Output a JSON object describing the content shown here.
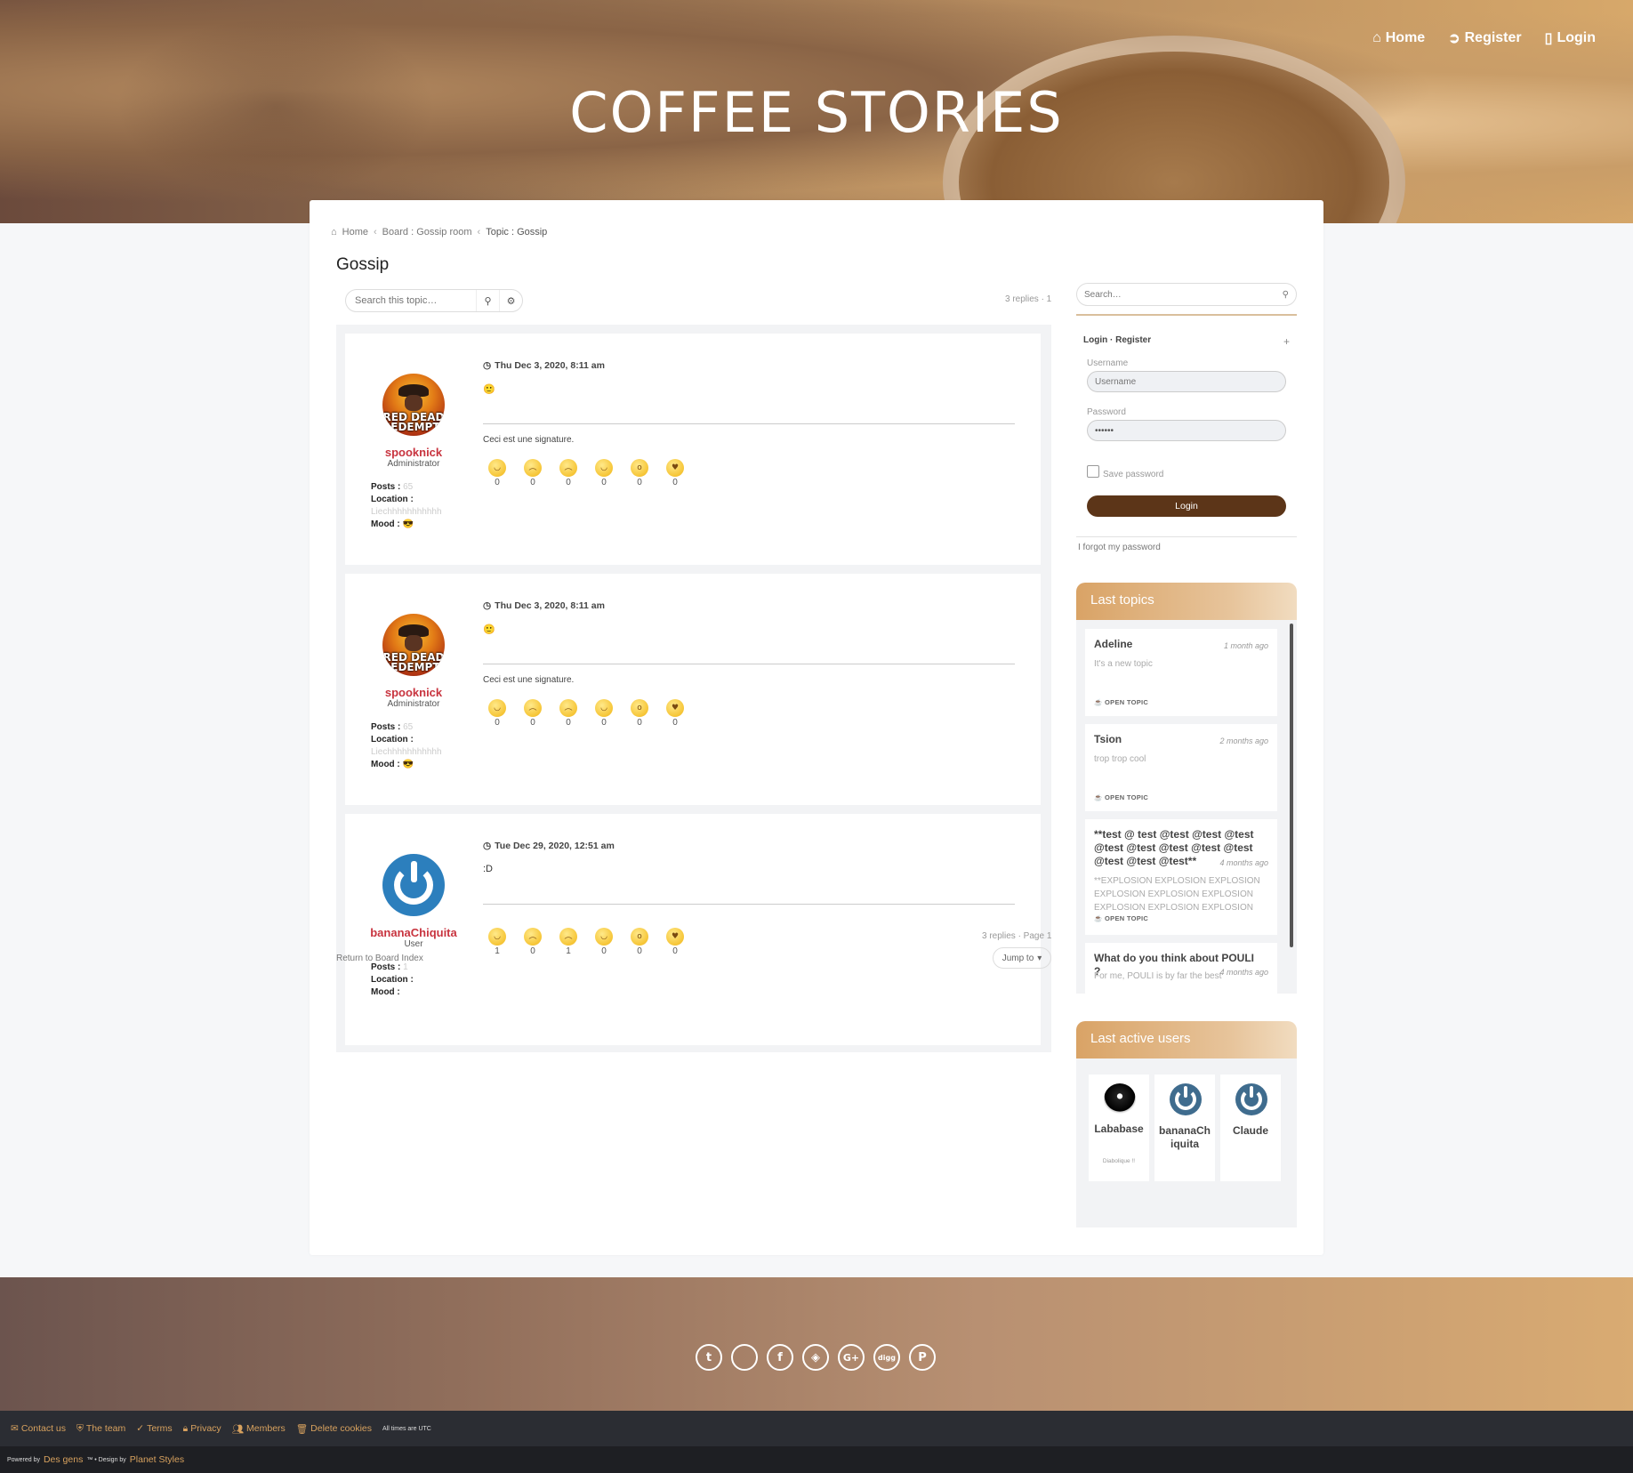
{
  "header": {
    "site_title": "COFFEE STORIES",
    "nav": [
      {
        "label": "Home",
        "icon": "home-icon"
      },
      {
        "label": "Register",
        "icon": "register-icon"
      },
      {
        "label": "Login",
        "icon": "clipboard-icon"
      }
    ]
  },
  "breadcrumb": {
    "home": "Home",
    "board": "Board : Gossip room",
    "topic": "Topic : Gossip"
  },
  "topic": {
    "title": "Gossip",
    "search_placeholder": "Search this topic…",
    "replies_top": "3 replies · 1",
    "replies_bottom": "3 replies · Page 1",
    "return_link": "Return to Board Index",
    "jump_to": "Jump to"
  },
  "posts": [
    {
      "username": "spooknick",
      "rank": "Administrator",
      "posts_label": "Posts :",
      "posts_value": "65",
      "location_label": "Location :",
      "location_value": "Liechhhhhhhhhhh",
      "mood_label": "Mood :",
      "mood_icon": "😎",
      "date": "Thu Dec 3, 2020, 8:11 am",
      "content": "🙂",
      "signature": "Ceci est une signature.",
      "reactions": [
        "0",
        "0",
        "0",
        "0",
        "0",
        "0"
      ]
    },
    {
      "username": "spooknick",
      "rank": "Administrator",
      "posts_label": "Posts :",
      "posts_value": "65",
      "location_label": "Location :",
      "location_value": "Liechhhhhhhhhhh",
      "mood_label": "Mood :",
      "mood_icon": "😎",
      "date": "Thu Dec 3, 2020, 8:11 am",
      "content": "🙂",
      "signature": "Ceci est une signature.",
      "reactions": [
        "0",
        "0",
        "0",
        "0",
        "0",
        "0"
      ]
    },
    {
      "username": "bananaChiquita",
      "rank": "User",
      "posts_label": "Posts :",
      "posts_value": "1",
      "location_label": "Location :",
      "location_value": "",
      "mood_label": "Mood :",
      "mood_icon": "",
      "date": "Tue Dec 29, 2020, 12:51 am",
      "content": ":D",
      "signature": "",
      "reactions": [
        "1",
        "0",
        "1",
        "0",
        "0",
        "0"
      ]
    }
  ],
  "avatar_text": {
    "rdr": "RED DEAD REDEMPTION"
  },
  "sidebar": {
    "search_placeholder": "Search…",
    "login": {
      "header": "Login · Register",
      "toggle": "+",
      "username_label": "Username",
      "username_placeholder": "Username",
      "password_label": "Password",
      "password_value": "••••••",
      "save_password": "Save password",
      "login_button": "Login",
      "forgot": "I forgot my password"
    },
    "last_topics": {
      "title": "Last topics",
      "items": [
        {
          "title": "Adeline",
          "ago": "1 month ago",
          "excerpt": "It's a new topic",
          "badge": "OPEN TOPIC"
        },
        {
          "title": "Tsion",
          "ago": "2 months ago",
          "excerpt": "trop trop cool",
          "badge": "OPEN TOPIC"
        },
        {
          "title": "**test @ test @test @test @test @test @test @test @test @test @test @test @test**",
          "ago": "4 months ago",
          "excerpt": "**EXPLOSION EXPLOSION EXPLOSION EXPLOSION EXPLOSION EXPLOSION EXPLOSION EXPLOSION EXPLOSION",
          "badge": "OPEN TOPIC"
        },
        {
          "title": "What do you think about POULI ?",
          "ago": "4 months ago",
          "excerpt": "For me, POULI is by far the best",
          "badge": ""
        }
      ]
    },
    "last_active": {
      "title": "Last active users",
      "users": [
        {
          "name": "Lababase",
          "mood": "Diabolique !!"
        },
        {
          "name": "bananaChiquita",
          "mood": ""
        },
        {
          "name": "Claude",
          "mood": ""
        }
      ]
    }
  },
  "footer": {
    "socials": [
      {
        "name": "twitter-icon",
        "glyph": "t"
      },
      {
        "name": "apple-icon",
        "glyph": ""
      },
      {
        "name": "facebook-icon",
        "glyph": "f"
      },
      {
        "name": "codepen-icon",
        "glyph": "◈"
      },
      {
        "name": "google-plus-icon",
        "glyph": "G+"
      },
      {
        "name": "digg-icon",
        "glyph": "digg"
      },
      {
        "name": "pinterest-icon",
        "glyph": "P"
      }
    ],
    "links": [
      "Contact us",
      "The team",
      "Terms",
      "Privacy",
      "Members",
      "Delete cookies"
    ],
    "utc": "All times are UTC",
    "powered_by": "Powered by",
    "powered_name": "Des gens",
    "design_by": "™ • Design by",
    "design_name": "Planet Styles"
  },
  "colors": {
    "accent": "#d7a15e",
    "login_button": "#5c3518",
    "username": "#c8343f",
    "footer_dark": "#2b2d33"
  }
}
